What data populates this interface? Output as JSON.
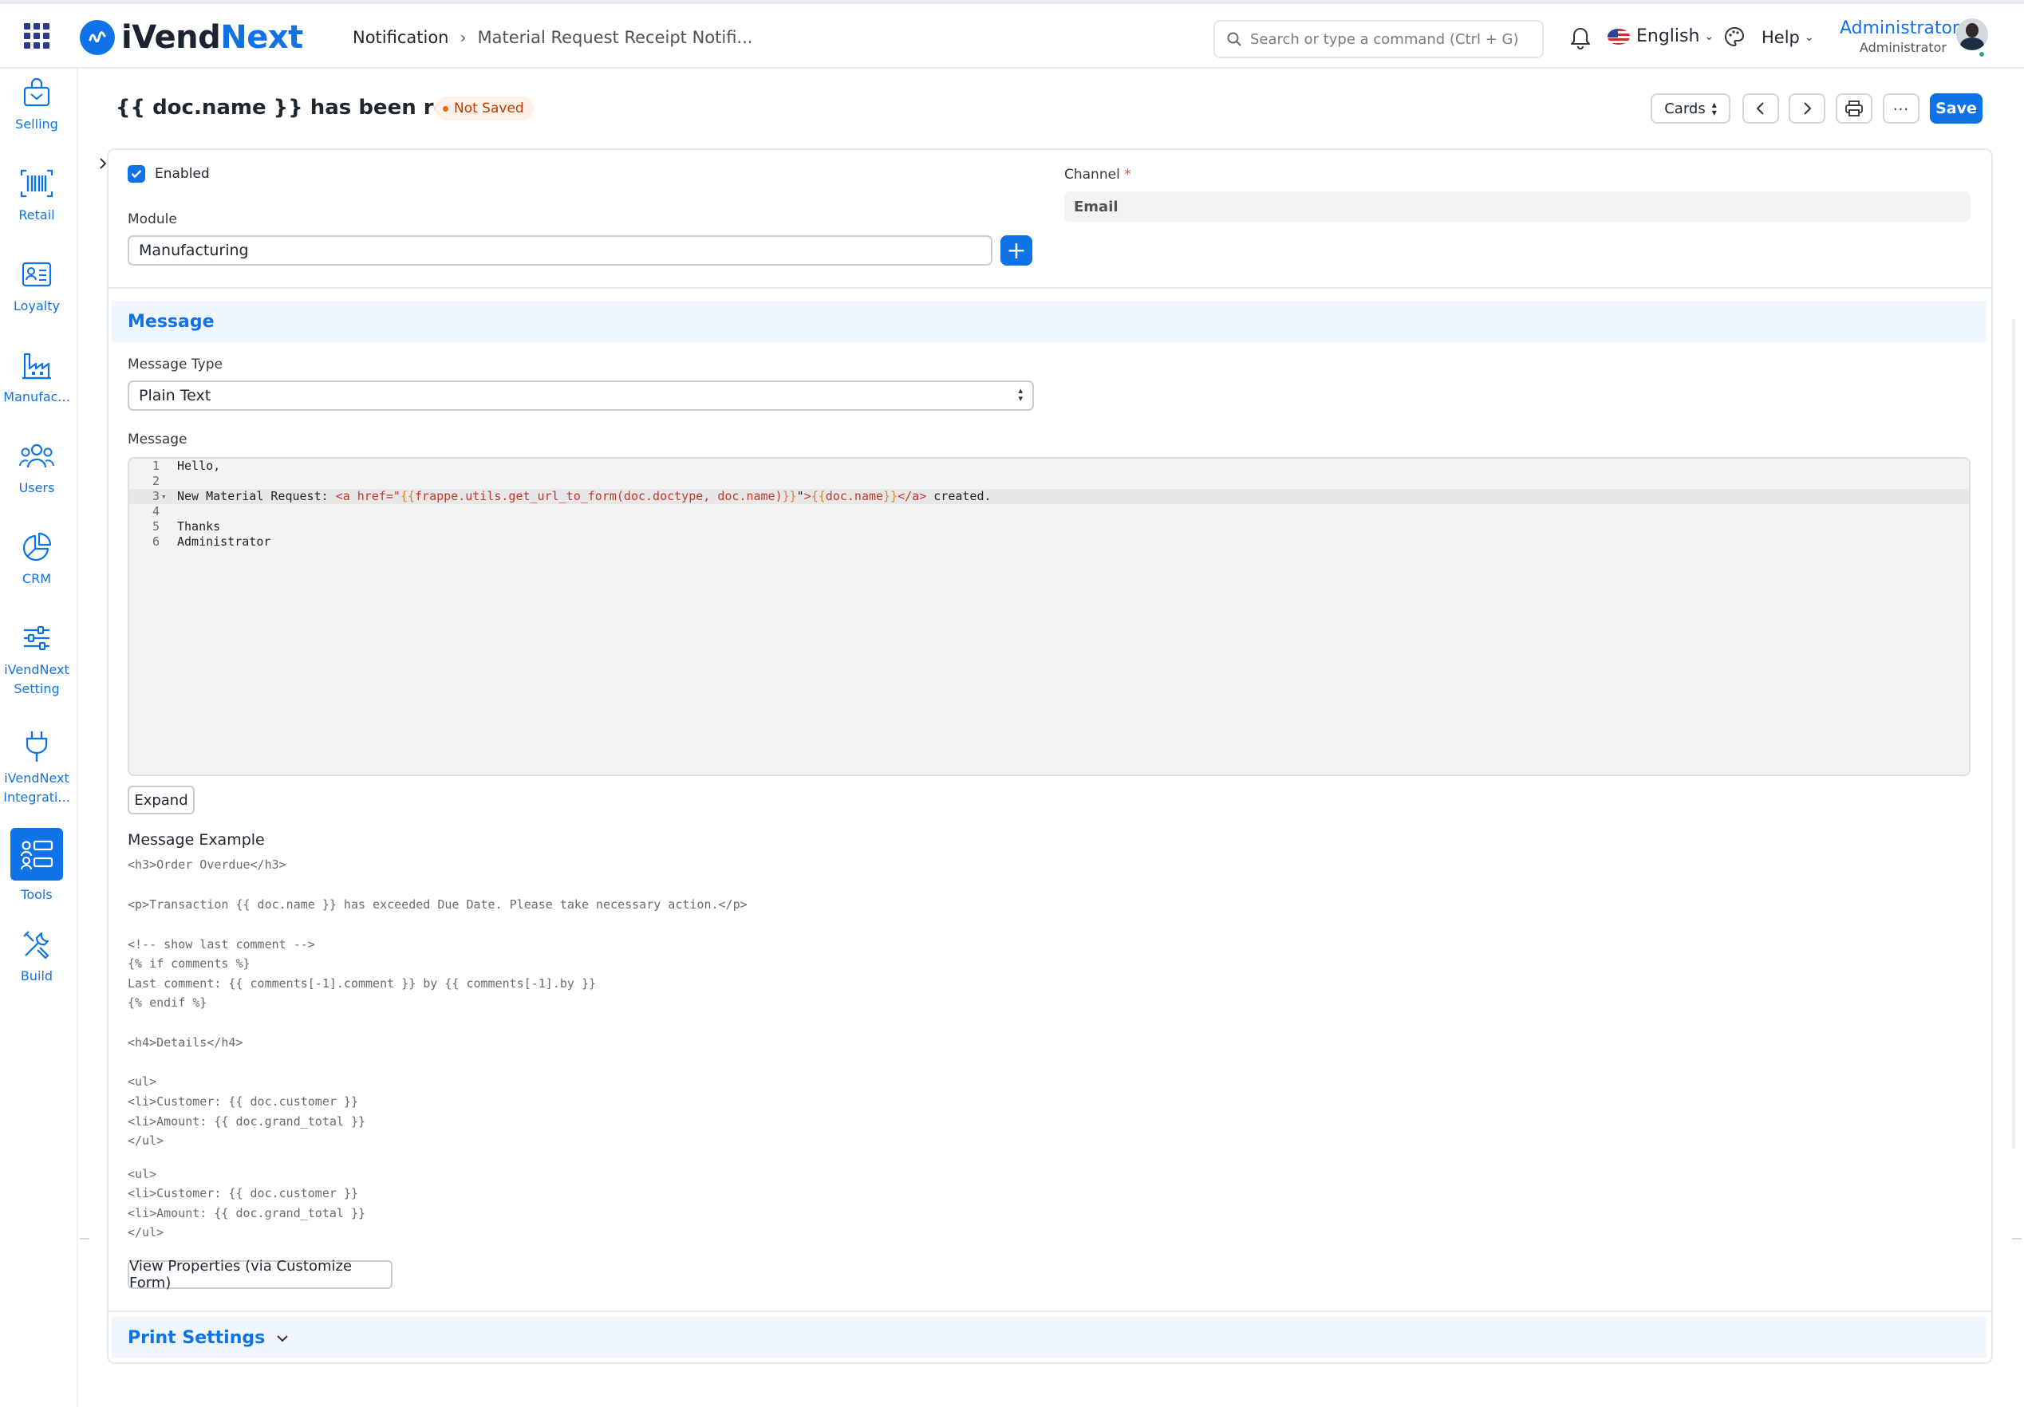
{
  "navbar": {
    "logo_part1": "iVend",
    "logo_part2": "Next",
    "breadcrumb": [
      "Notification",
      "Material Request Receipt Notifi..."
    ],
    "search_placeholder": "Search or type a command (Ctrl + G)",
    "language": "English",
    "help": "Help",
    "user_name": "Administrator",
    "user_role": "Administrator"
  },
  "sidebar": {
    "items": [
      {
        "label": "Selling",
        "icon": "shop-bag-icon"
      },
      {
        "label": "Retail",
        "icon": "barcode-icon"
      },
      {
        "label": "Loyalty",
        "icon": "id-card-icon"
      },
      {
        "label": "Manufac...",
        "icon": "factory-icon"
      },
      {
        "label": "Users",
        "icon": "users-icon"
      },
      {
        "label": "CRM",
        "icon": "pie-chart-icon"
      },
      {
        "label": "iVendNext Setting",
        "icon": "sliders-icon"
      },
      {
        "label": "iVendNext Integrati...",
        "icon": "plug-icon"
      },
      {
        "label": "Tools",
        "icon": "tools-icon",
        "active": true
      },
      {
        "label": "Build",
        "icon": "wrench-icon"
      }
    ]
  },
  "page": {
    "title": "{{ doc.name }} has been received",
    "status": "Not Saved",
    "view_select": "Cards",
    "save": "Save"
  },
  "form": {
    "enabled_label": "Enabled",
    "enabled": true,
    "channel_label": "Channel",
    "channel_value": "Email",
    "module_label": "Module",
    "module_value": "Manufacturing",
    "message_section": "Message",
    "message_type_label": "Message Type",
    "message_type_value": "Plain Text",
    "message_label": "Message",
    "code_lines": [
      "Hello,",
      "",
      "New Material Request: <a href=\"{{frappe.utils.get_url_to_form(doc.doctype, doc.name)}}\">{{doc.name}}</a> created.",
      "",
      "Thanks",
      "Administrator"
    ],
    "expand": "Expand",
    "example_title": "Message Example",
    "example_lines": [
      "<h3>Order Overdue</h3>",
      "",
      "<p>Transaction {{ doc.name }} has exceeded Due Date. Please take necessary action.</p>",
      "",
      "<!-- show last comment -->",
      "{% if comments %}",
      "Last comment: {{ comments[-1].comment }} by {{ comments[-1].by }}",
      "{% endif %}",
      "",
      "<h4>Details</h4>",
      "",
      "<ul>",
      "<li>Customer: {{ doc.customer }}",
      "<li>Amount: {{ doc.grand_total }}",
      "</ul>",
      "",
      "<ul>",
      "<li>Customer: {{ doc.customer }}",
      "<li>Amount: {{ doc.grand_total }}",
      "</ul>"
    ],
    "customize_button": "View Properties (via Customize Form)",
    "print_section": "Print Settings"
  },
  "colors": {
    "accent": "#0f73e7",
    "status_bg": "#fff1e7",
    "status_text": "#bc3a00"
  }
}
